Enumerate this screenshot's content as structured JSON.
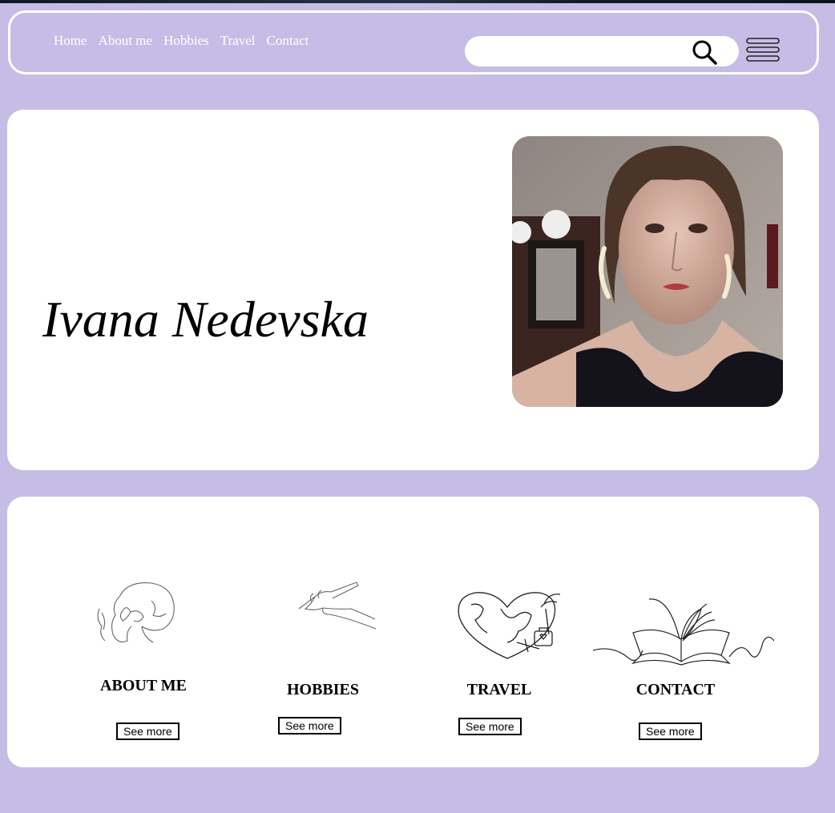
{
  "nav": {
    "links": [
      "Home",
      "About me",
      "Hobbies",
      "Travel",
      "Contact"
    ]
  },
  "search": {
    "value": "",
    "placeholder": ""
  },
  "hero": {
    "name": "Ivana Nedevska"
  },
  "cards": [
    {
      "title": "ABOUT ME",
      "button": "See more",
      "icon": "woman-line-drawing-icon"
    },
    {
      "title": "HOBBIES",
      "button": "See more",
      "icon": "hand-writing-icon"
    },
    {
      "title": "TRAVEL",
      "button": "See more",
      "icon": "heart-globe-icon"
    },
    {
      "title": "CONTACT",
      "button": "See more",
      "icon": "open-book-icon"
    }
  ],
  "colors": {
    "background": "#c6bde6",
    "panel": "#ffffff",
    "nav_text": "#ffffff"
  }
}
